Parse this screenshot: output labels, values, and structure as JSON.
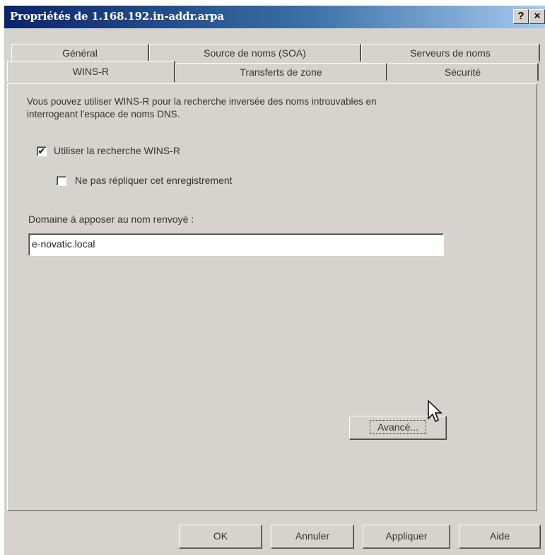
{
  "window": {
    "title": "Propriétés de 1.168.192.in-addr.arpa",
    "help_label": "?",
    "close_label": "×"
  },
  "tabs_back": [
    "Général",
    "Source de noms (SOA)",
    "Serveurs de noms"
  ],
  "tabs_front": [
    "WINS-R",
    "Transferts de zone",
    "Sécurité"
  ],
  "active_tab": "WINS-R",
  "description": "Vous pouvez utiliser WINS-R pour la recherche inversée des noms introuvables en interrogeant l'espace de noms DNS.",
  "use_wins_r": {
    "label": "Utiliser la recherche WINS-R",
    "checked": true,
    "mark": "✔"
  },
  "no_replicate": {
    "label": "Ne pas répliquer cet enregistrement",
    "checked": false
  },
  "domain": {
    "label": "Domaine à apposer au nom renvoyé :",
    "value": "e-novatic.local"
  },
  "buttons": {
    "advanced": "Avancé...",
    "ok": "OK",
    "cancel": "Annuler",
    "apply": "Appliquer",
    "help": "Aide"
  }
}
